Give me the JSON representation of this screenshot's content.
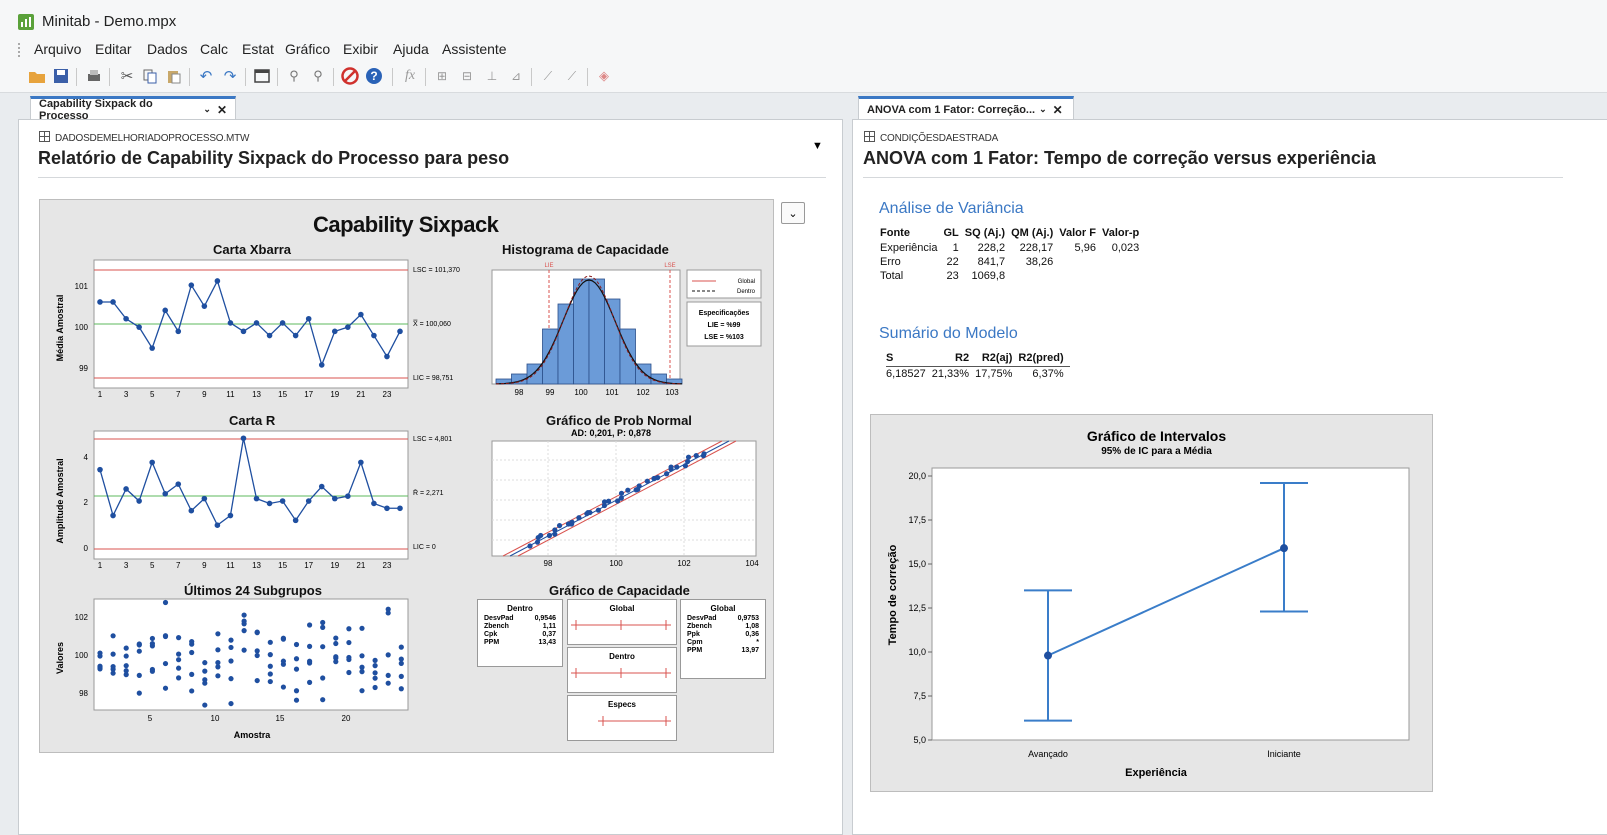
{
  "app": {
    "title": "Minitab - Demo.mpx"
  },
  "menu": [
    "Arquivo",
    "Editar",
    "Dados",
    "Calc",
    "Estat",
    "Gráfico",
    "Exibir",
    "Ajuda",
    "Assistente"
  ],
  "toolbar": {
    "icons": [
      "open-folder-icon",
      "save-icon",
      "print-icon",
      "cut-icon",
      "copy-icon",
      "paste-icon",
      "undo-icon",
      "redo-icon",
      "window-icon",
      "find-icon",
      "find-next-icon",
      "stop-icon",
      "help-icon",
      "fx-icon",
      "columns-icon",
      "rows-icon",
      "tree-icon",
      "graph-icon",
      "edit-graph-icon",
      "brush-icon",
      "eraser-icon"
    ]
  },
  "left": {
    "tab_label": "Capability Sixpack do Processo",
    "worksheet": "DADOSDEMELHORIADOPROCESSO.MTW",
    "title": "Relatório de Capability Sixpack do Processo para peso",
    "sixpack": {
      "title": "Capability Sixpack",
      "xbar": {
        "title": "Carta Xbarra",
        "ylabel": "Média Amostral",
        "yticks": [
          "101",
          "100",
          "99"
        ],
        "xticks": [
          "1",
          "3",
          "5",
          "7",
          "9",
          "11",
          "13",
          "15",
          "17",
          "19",
          "21",
          "23"
        ],
        "lsc": "LSC = 101,370",
        "center": "X̿ = 100,060",
        "lic": "LIC = 98,751",
        "values": [
          100.6,
          100.6,
          100.2,
          100.0,
          99.5,
          100.4,
          99.9,
          101.0,
          100.5,
          101.1,
          100.1,
          99.9,
          100.1,
          99.8,
          100.1,
          99.8,
          100.2,
          99.1,
          99.9,
          100.0,
          100.3,
          99.8,
          99.3,
          99.9
        ]
      },
      "r": {
        "title": "Carta R",
        "ylabel": "Amplitude Amostral",
        "yticks": [
          "4",
          "2",
          "0"
        ],
        "xticks": [
          "1",
          "3",
          "5",
          "7",
          "9",
          "11",
          "13",
          "15",
          "17",
          "19",
          "21",
          "23"
        ],
        "lsc": "LSC = 4,801",
        "center": "R̄ = 2,271",
        "lic": "LIC = 0",
        "values": [
          3.4,
          1.5,
          2.6,
          2.1,
          3.7,
          2.4,
          2.8,
          1.7,
          2.2,
          1.1,
          1.5,
          4.7,
          2.2,
          2.0,
          2.1,
          1.3,
          2.1,
          2.7,
          2.2,
          2.3,
          3.7,
          2.0,
          1.8,
          1.8
        ]
      },
      "last": {
        "title": "Últimos 24 Subgrupos",
        "ylabel": "Valores",
        "xlabel": "Amostra",
        "yticks": [
          "102",
          "100",
          "98"
        ],
        "xticks": [
          "5",
          "10",
          "15",
          "20"
        ]
      },
      "hist": {
        "title": "Histograma de Capacidade",
        "lie_tag": "LIE",
        "lse_tag": "LSE",
        "xticks": [
          "98",
          "99",
          "100",
          "101",
          "102",
          "103"
        ],
        "bins": [
          1,
          2,
          4,
          11,
          16,
          21,
          21,
          17,
          11,
          4,
          2,
          1
        ],
        "legend": [
          "Global",
          "Dentro"
        ],
        "spec_title": "Especificações",
        "lie": "LIE = %99",
        "lse": "LSE = %103"
      },
      "prob": {
        "title": "Gráfico de Prob Normal",
        "subtitle": "AD: 0,201, P: 0,878",
        "xticks": [
          "98",
          "100",
          "102",
          "104"
        ]
      },
      "cap": {
        "title": "Gráfico de Capacidade",
        "dentro": {
          "head": "Dentro",
          "rows": [
            [
              "DesvPad",
              "0,9546"
            ],
            [
              "Zbench",
              "1,11"
            ],
            [
              "Cpk",
              "0,37"
            ],
            [
              "PPM",
              "13,43"
            ]
          ]
        },
        "global": {
          "head": "Global",
          "rows": [
            [
              "DesvPad",
              "0,9753"
            ],
            [
              "Zbench",
              "1,08"
            ],
            [
              "Ppk",
              "0,36"
            ],
            [
              "Cpm",
              "*"
            ],
            [
              "PPM",
              "13,97"
            ]
          ]
        },
        "bars": [
          "Global",
          "Dentro",
          "Especs"
        ]
      }
    }
  },
  "right": {
    "tab_label": "ANOVA com 1 Fator: Correção...",
    "worksheet": "CONDIÇÕESDAESTRADA",
    "title": "ANOVA com 1 Fator: Tempo de correção versus experiência",
    "anova": {
      "heading": "Análise de Variância",
      "headers": [
        "Fonte",
        "GL",
        "SQ (Aj.)",
        "QM (Aj.)",
        "Valor F",
        "Valor-p"
      ],
      "rows": [
        [
          "Experiência",
          "1",
          "228,2",
          "228,17",
          "5,96",
          "0,023"
        ],
        [
          "Erro",
          "22",
          "841,7",
          "38,26",
          "",
          ""
        ],
        [
          "Total",
          "23",
          "1069,8",
          "",
          "",
          ""
        ]
      ]
    },
    "model": {
      "heading": "Sumário do Modelo",
      "headers": [
        "S",
        "R2",
        "R2(aj)",
        "R2(pred)"
      ],
      "rows": [
        [
          "6,18527",
          "21,33%",
          "17,75%",
          "6,37%"
        ]
      ]
    },
    "intervals": {
      "title": "Gráfico de Intervalos",
      "subtitle": "95% de IC para a Média",
      "ylabel": "Tempo de correção",
      "xlabel": "Experiência"
    }
  },
  "chart_data": [
    {
      "type": "line",
      "title": "Gráfico de Intervalos",
      "subtitle": "95% de IC para a Média",
      "xlabel": "Experiência",
      "ylabel": "Tempo de correção",
      "categories": [
        "Avançado",
        "Iniciante"
      ],
      "series": [
        {
          "values": [
            9.8,
            15.9
          ],
          "lower": [
            6.1,
            12.3
          ],
          "upper": [
            13.5,
            19.6
          ]
        }
      ],
      "ylim": [
        5.0,
        20.0
      ],
      "yticks": [
        "20,0",
        "17,5",
        "15,0",
        "12,5",
        "10,0",
        "7,5",
        "5,0"
      ]
    }
  ],
  "colors": {
    "accent": "#3b78c4",
    "marker": "#1f4fa0",
    "center": "#5cb85c",
    "limit": "#d9534f",
    "bar": "#6b9bd8"
  }
}
